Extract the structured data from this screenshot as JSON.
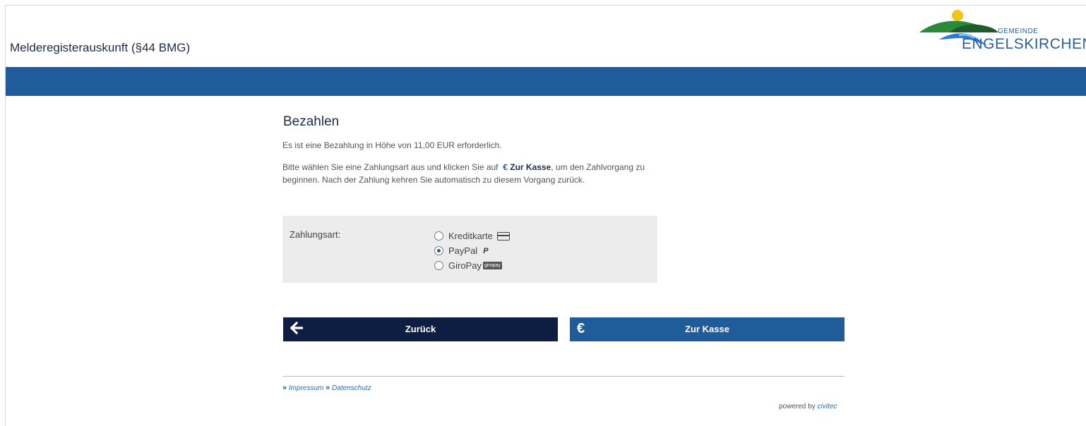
{
  "header": {
    "app_title": "Melderegisterauskunft (§44 BMG)",
    "logo": {
      "small_text": "GEMEINDE",
      "big_text": "ENGELSKIRCHEN",
      "icon": "engelskirchen-logo"
    },
    "bar_color": "#1f5c99"
  },
  "main": {
    "heading": "Bezahlen",
    "intro": "Es ist eine Bezahlung in Höhe von 11,00 EUR erforderlich.",
    "instruction_before": "Bitte wählen Sie eine Zahlungsart aus und klicken Sie auf",
    "instruction_euro": "€",
    "instruction_kasse": "Zur Kasse",
    "instruction_after": ", um den Zahlvorgang zu beginnen. Nach der Zahlung kehren Sie automatisch zu diesem Vorgang zurück.",
    "payment": {
      "label": "Zahlungsart:",
      "options": [
        {
          "label": "Kreditkarte",
          "icon": "credit-card-icon",
          "selected": false
        },
        {
          "label": "PayPal",
          "icon": "paypal-icon",
          "icon_text": "P",
          "selected": true
        },
        {
          "label": "GiroPay",
          "icon": "giropay-icon",
          "icon_text": "giropay",
          "selected": false
        }
      ]
    },
    "buttons": {
      "back_label": "Zurück",
      "back_icon": "arrow-left-icon",
      "kasse_label": "Zur Kasse",
      "kasse_icon": "euro-icon"
    }
  },
  "footer": {
    "links": [
      "Impressum",
      "Datenschutz"
    ],
    "chevron": "»",
    "powered_prefix": "powered by",
    "powered_brand": "civitec"
  },
  "colors": {
    "primary": "#1f5c99",
    "dark": "#0d1e42",
    "panel": "#ececec"
  }
}
